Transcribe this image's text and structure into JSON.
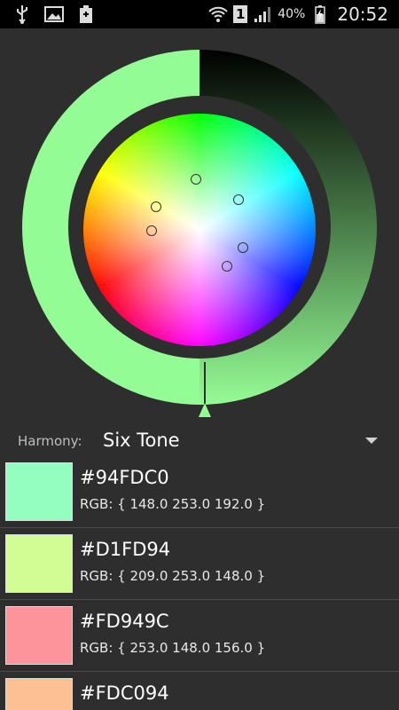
{
  "status_bar": {
    "left_icons": [
      "usb-icon",
      "image-icon",
      "battery-saver-icon"
    ],
    "sim_label": "1",
    "battery_percent": "40%",
    "time": "20:52"
  },
  "harmony": {
    "label": "Harmony:",
    "value": "Six Tone"
  },
  "colors": {
    "ring_selected": "#94fc94",
    "ring_value_start": "#000000",
    "ring_value_end": "#94fc94",
    "background": "#2e2e2e"
  },
  "swatches": [
    {
      "hex": "#94FDC0",
      "rgb": "RGB: { 148.0 253.0 192.0 }",
      "color": "#94FDC0"
    },
    {
      "hex": "#D1FD94",
      "rgb": "RGB: { 209.0 253.0 148.0 }",
      "color": "#D1FD94"
    },
    {
      "hex": "#FD949C",
      "rgb": "RGB: { 253.0 148.0 156.0 }",
      "color": "#FD949C"
    },
    {
      "hex": "#FDC094",
      "rgb": "",
      "color": "#FDC094"
    }
  ]
}
